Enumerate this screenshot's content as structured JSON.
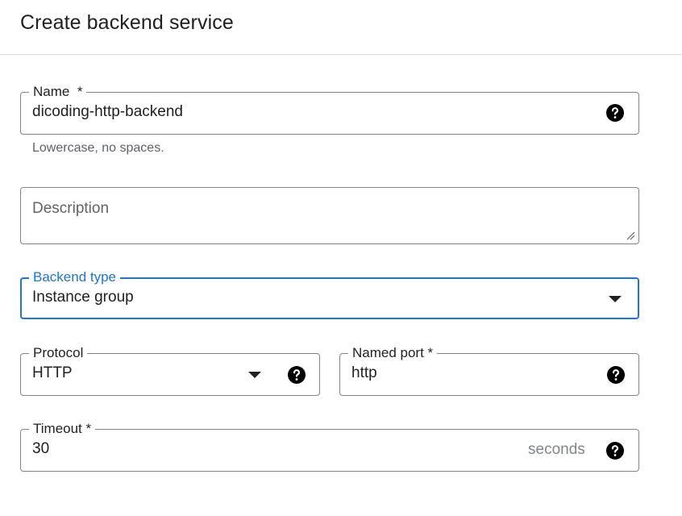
{
  "header": {
    "title": "Create backend service"
  },
  "name_field": {
    "label": "Name",
    "required_mark": "*",
    "value": "dicoding-http-backend",
    "hint": "Lowercase, no spaces.",
    "icon": "help-icon"
  },
  "description_field": {
    "placeholder": "Description"
  },
  "backend_type": {
    "label": "Backend type",
    "value": "Instance group",
    "icon": "dropdown-arrow-icon",
    "accent_color": "#1a73e8"
  },
  "protocol": {
    "label": "Protocol",
    "value": "HTTP",
    "icon": "dropdown-arrow-icon"
  },
  "named_port": {
    "label": "Named port *",
    "value": "http",
    "icon": "help-icon"
  },
  "timeout": {
    "label": "Timeout *",
    "value": "30",
    "suffix": "seconds",
    "icon": "help-icon"
  }
}
